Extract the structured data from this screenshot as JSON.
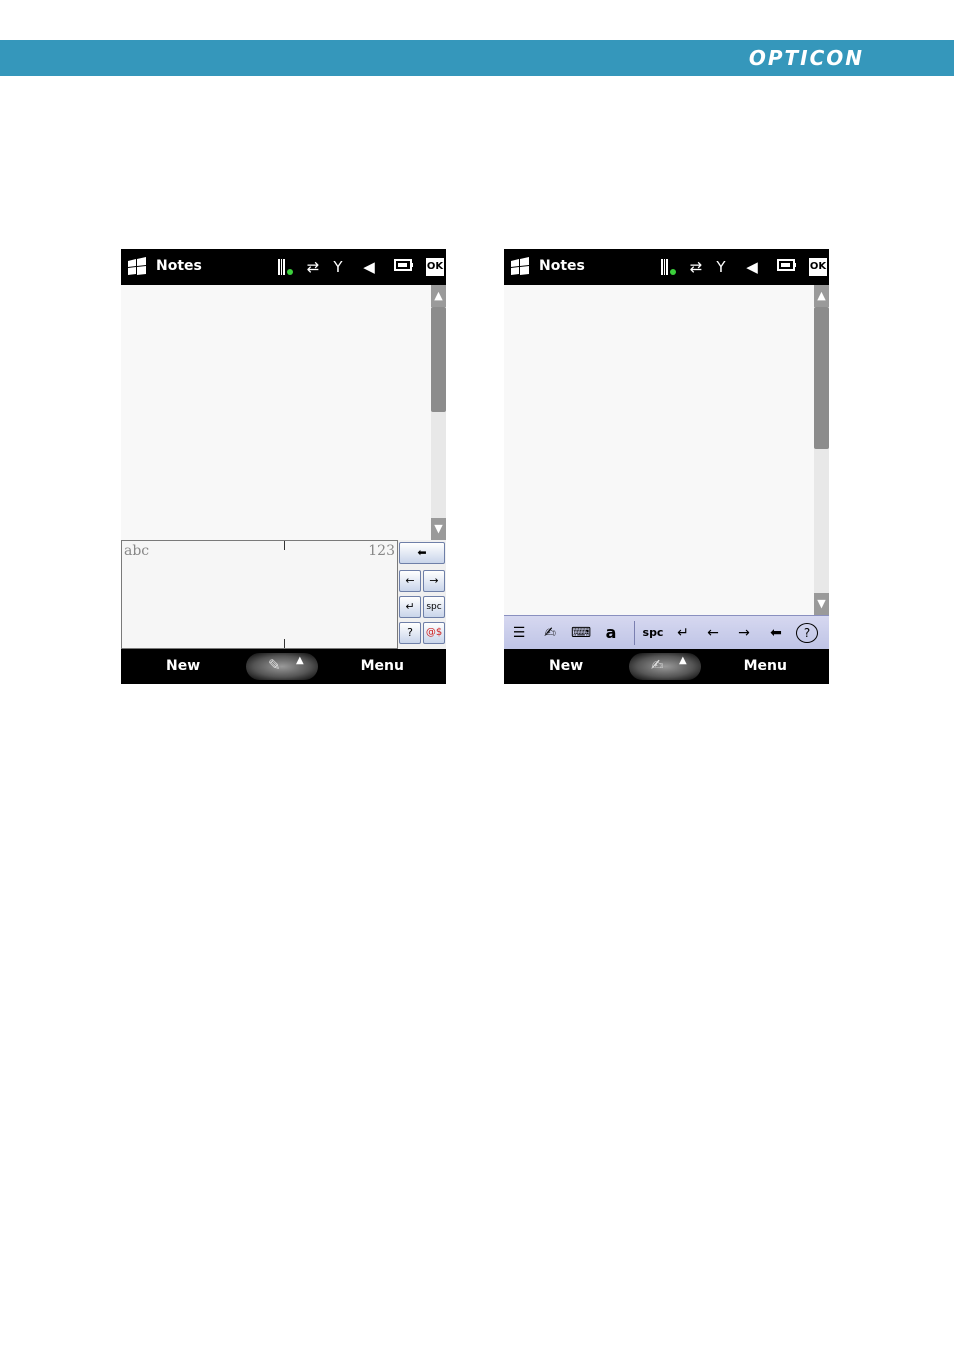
{
  "brand": {
    "logo_text": "OPTICON",
    "bar_color": "#3597bb"
  },
  "screens": [
    {
      "title": "Notes",
      "status_icons": [
        "barcode-icon",
        "sync-arrows-icon",
        "signal-antenna-icon",
        "speaker-muted-icon",
        "battery-icon"
      ],
      "ok_label": "OK",
      "input_method": "Letter Recognizer",
      "handwriting": {
        "left_label": "abc",
        "right_label": "123"
      },
      "keys": {
        "backspace": "⬅",
        "left": "←",
        "right": "→",
        "enter": "↵",
        "space": "spc",
        "help": "?",
        "symbols": "@$"
      },
      "softkeys": {
        "left": "New",
        "right": "Menu"
      },
      "sip_icon": "pen-icon"
    },
    {
      "title": "Notes",
      "status_icons": [
        "barcode-icon",
        "sync-arrows-icon",
        "signal-antenna-icon",
        "speaker-muted-icon",
        "battery-icon"
      ],
      "ok_label": "OK",
      "input_method": "Transcriber",
      "toolbar": {
        "space": "spc",
        "enter": "↵",
        "left": "←",
        "right": "→",
        "backspace": "⬅",
        "help": "?",
        "letter": "a"
      },
      "softkeys": {
        "left": "New",
        "right": "Menu"
      },
      "sip_icon": "transcriber-pen-icon"
    }
  ]
}
